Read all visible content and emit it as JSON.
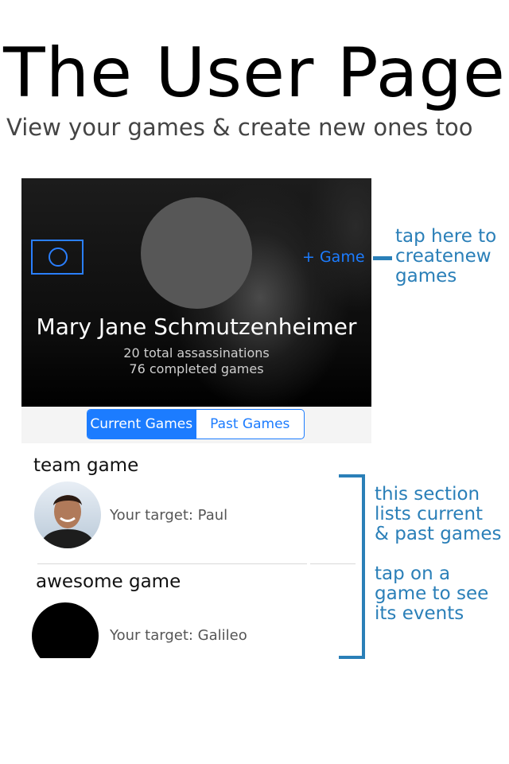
{
  "header": {
    "title": "The User Page",
    "subtitle": "View your games & create new ones too"
  },
  "profile": {
    "name": "Mary Jane Schmutzenheimer",
    "stats": [
      "20 total assassinations",
      "76 completed games"
    ],
    "add_game_label": "+ Game",
    "camera_icon": "camera-icon"
  },
  "tabs": [
    {
      "label": "Current Games",
      "active": true
    },
    {
      "label": "Past Games",
      "active": false
    }
  ],
  "games": [
    {
      "title": "team game",
      "target": "Your target: Paul"
    },
    {
      "title": "awesome game",
      "target": "Your target: Galileo"
    }
  ],
  "annotations": {
    "add_game_note": [
      "tap here to",
      "createnew",
      "games"
    ],
    "list_note": [
      "this section",
      "lists current",
      "& past games"
    ],
    "tap_note": [
      "tap on a",
      "game to see",
      "its events"
    ]
  },
  "colors": {
    "accent": "#1c7cff",
    "annotation": "#2a7fb8"
  }
}
